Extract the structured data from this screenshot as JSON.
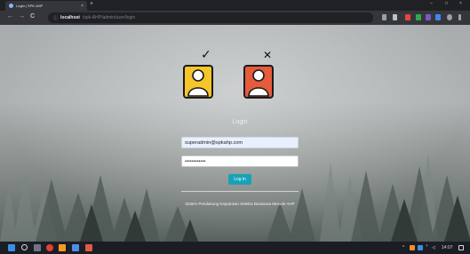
{
  "browser": {
    "tab_title": "Login | SPK AHP",
    "tab_close": "×",
    "new_tab": "+",
    "window_controls": {
      "minimize": "–",
      "maximize": "□",
      "close": "×"
    },
    "nav": {
      "back": "←",
      "forward": "→",
      "reload": "C"
    },
    "url_lock": "ⓘ",
    "url_host": "localhost",
    "url_path": "/spk-AHP/admin/user/login"
  },
  "page": {
    "logo_check": "✓",
    "logo_cross": "✕",
    "heading": "Login",
    "email_value": "superadmin@spkahp.com",
    "password_value": "••••••••••••",
    "login_button": "Log in",
    "footer": "Sistem Pendukung Keputusan Seleksi Beasiswa Metode AHP"
  },
  "taskbar": {
    "time": "14:07",
    "wifi": "ꜛ",
    "volume": "◁"
  },
  "colors": {
    "accent": "#17a2b8",
    "logo_yellow": "#f6c42b",
    "logo_red": "#e55b3c",
    "browser_dark": "#202124",
    "browser_toolbar": "#35363a"
  },
  "icons": [
    "browser-favicon-icon",
    "back-arrow-icon",
    "forward-arrow-icon",
    "reload-icon",
    "info-icon",
    "check-icon",
    "cross-icon",
    "user-icon",
    "windows-start-icon",
    "search-icon",
    "chrome-icon",
    "folder-icon",
    "wifi-icon",
    "volume-icon"
  ]
}
